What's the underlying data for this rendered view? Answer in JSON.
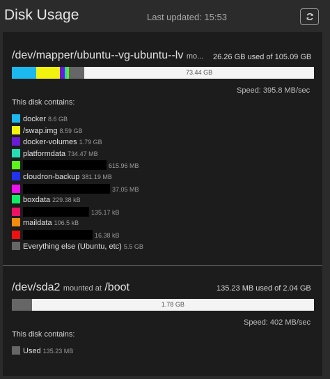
{
  "header": {
    "title": "Disk Usage",
    "last_updated": "Last updated: 15:53"
  },
  "disks": [
    {
      "name": "/dev/mapper/ubuntu--vg-ubuntu--lv",
      "mount_text": "mo...",
      "usage": "26.26 GB used of 105.09 GB",
      "free_label": "73.44 GB",
      "speed": "Speed: 395.8 MB/sec",
      "contains_label": "This disk contains:",
      "segments": [
        {
          "color": "#1cb8f0",
          "percent": 8.0
        },
        {
          "color": "#f2f20f",
          "percent": 8.0
        },
        {
          "color": "#6a1bd6",
          "percent": 1.6
        },
        {
          "color": "#24ddb5",
          "percent": 0.7
        },
        {
          "color": "#5cf21a",
          "percent": 0.6
        },
        {
          "color": "#666666",
          "percent": 5.1
        }
      ],
      "items": [
        {
          "label": "docker",
          "size": "8.6 GB",
          "color": "#1cb8f0"
        },
        {
          "label": "/swap.img",
          "size": "8.59 GB",
          "color": "#f2f20f"
        },
        {
          "label": "docker-volumes",
          "size": "1.79 GB",
          "color": "#6a1bd6"
        },
        {
          "label": "platformdata",
          "size": "734.47 MB",
          "color": "#24ddb5"
        },
        {
          "label": "",
          "size": "615.96 MB",
          "color": "#5cf21a",
          "redacted": 120
        },
        {
          "label": "cloudron-backup",
          "size": "381.19 MB",
          "color": "#2233ee"
        },
        {
          "label": "",
          "size": "37.05 MB",
          "color": "#ee11ee",
          "redacted": 125
        },
        {
          "label": "boxdata",
          "size": "229.38 kB",
          "color": "#11ee66"
        },
        {
          "label": "",
          "size": "135.17 kB",
          "color": "#ee1166",
          "redacted": 95
        },
        {
          "label": "maildata",
          "size": "106.5 kB",
          "color": "#f28c0f"
        },
        {
          "label": "",
          "size": "16.38 kB",
          "color": "#ee1111",
          "redacted": 100
        },
        {
          "label": "Everything else (Ubuntu, etc)",
          "size": "5.5 GB",
          "color": "#666666"
        }
      ]
    },
    {
      "name": "/dev/sda2",
      "mount_prefix": "mounted at",
      "mount_point": "/boot",
      "usage": "135.23 MB used of 2.04 GB",
      "free_label": "1.78 GB",
      "speed": "Speed: 402 MB/sec",
      "contains_label": "This disk contains:",
      "segments": [
        {
          "color": "#666666",
          "percent": 6.6
        }
      ],
      "items": [
        {
          "label": "Used",
          "size": "135.23 MB",
          "color": "#666666"
        }
      ]
    }
  ]
}
